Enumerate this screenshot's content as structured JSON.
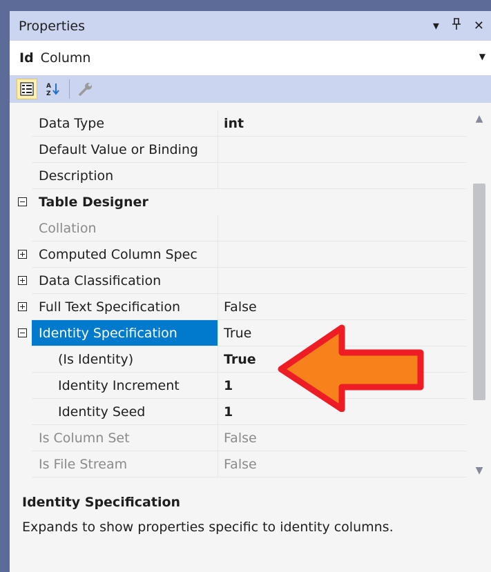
{
  "panel": {
    "title": "Properties",
    "controls": {
      "dropdown": "▾",
      "pin": "ꟸ",
      "close": "✕"
    }
  },
  "object": {
    "name": "Id",
    "type": "Column"
  },
  "toolbar": {
    "categorized_active": true
  },
  "rows": [
    {
      "name": "Data Type",
      "value": "int",
      "indent": 0,
      "glyph": "",
      "state": "bold"
    },
    {
      "name": "Default Value or Binding",
      "value": "",
      "indent": 0,
      "glyph": "",
      "state": ""
    },
    {
      "name": "Description",
      "value": "",
      "indent": 0,
      "glyph": "",
      "state": ""
    },
    {
      "name": "Table Designer",
      "value": "",
      "indent": 0,
      "glyph": "minus",
      "state": "category"
    },
    {
      "name": "Collation",
      "value": "",
      "indent": 0,
      "glyph": "",
      "state": "disabled"
    },
    {
      "name": "Computed Column Spec",
      "value": "",
      "indent": 0,
      "glyph": "plus",
      "state": ""
    },
    {
      "name": "Data Classification",
      "value": "",
      "indent": 0,
      "glyph": "plus",
      "state": ""
    },
    {
      "name": "Full Text Specification",
      "value": "False",
      "indent": 0,
      "glyph": "plus",
      "state": ""
    },
    {
      "name": "Identity Specification",
      "value": "True",
      "indent": 0,
      "glyph": "minus",
      "state": "selected"
    },
    {
      "name": "(Is Identity)",
      "value": "True",
      "indent": 1,
      "glyph": "",
      "state": "bold"
    },
    {
      "name": "Identity Increment",
      "value": "1",
      "indent": 1,
      "glyph": "",
      "state": "bold"
    },
    {
      "name": "Identity Seed",
      "value": "1",
      "indent": 1,
      "glyph": "",
      "state": "bold"
    },
    {
      "name": "Is Column Set",
      "value": "False",
      "indent": 0,
      "glyph": "",
      "state": "disabled"
    },
    {
      "name": "Is File Stream",
      "value": "False",
      "indent": 0,
      "glyph": "",
      "state": "disabled"
    }
  ],
  "description": {
    "title": "Identity Specification",
    "text": "Expands to show properties specific to identity columns."
  },
  "colors": {
    "accent": "#007acc",
    "arrow_fill": "#f7821b",
    "arrow_stroke": "#ee1c24"
  }
}
